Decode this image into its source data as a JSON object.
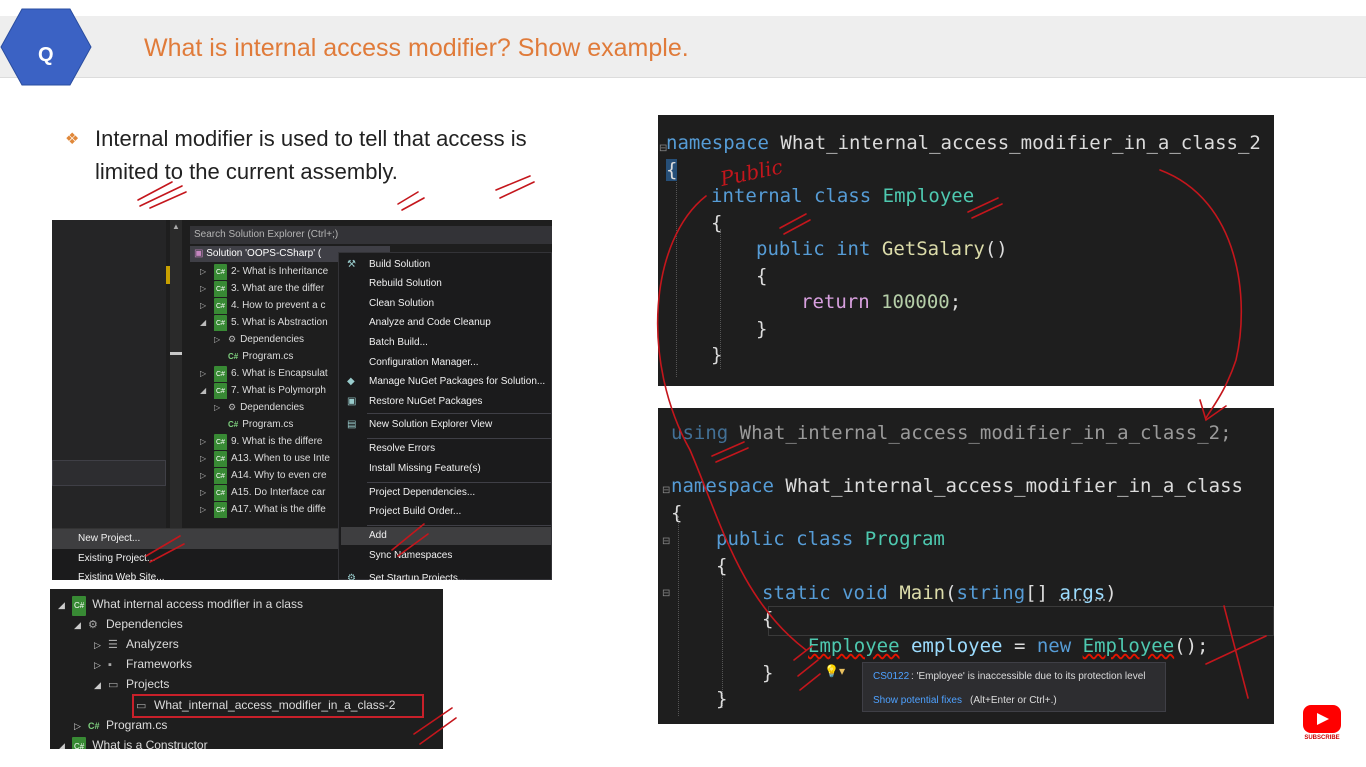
{
  "header": {
    "badge": "Q",
    "title": "What is internal access modifier? Show example."
  },
  "bullet": {
    "icon": "diamond-bullet-icon",
    "text": "Internal modifier is used to tell that access is limited to the current assembly."
  },
  "solution_explorer": {
    "search_placeholder": "Search Solution Explorer (Ctrl+;)",
    "solution_label": "Solution 'OOPS-CSharp' (",
    "tree": [
      {
        "label": "2- What is Inheritance",
        "type": "cs"
      },
      {
        "label": "3. What are the differ",
        "type": "cs"
      },
      {
        "label": "4. How to prevent a c",
        "type": "cs"
      },
      {
        "label": "5. What is Abstraction",
        "type": "cs"
      },
      {
        "label": "Dependencies",
        "type": "dep"
      },
      {
        "label": "Program.cs",
        "type": "file"
      },
      {
        "label": "6. What is Encapsulat",
        "type": "cs"
      },
      {
        "label": "7. What is Polymorph",
        "type": "cs"
      },
      {
        "label": "Dependencies",
        "type": "dep"
      },
      {
        "label": "Program.cs",
        "type": "file"
      },
      {
        "label": "9. What is the differe",
        "type": "cs"
      },
      {
        "label": "A13. When to use Inte",
        "type": "cs"
      },
      {
        "label": "A14. Why to even cre",
        "type": "cs"
      },
      {
        "label": "A15. Do Interface car",
        "type": "cs"
      },
      {
        "label": "A17. What is the diffe",
        "type": "cs"
      }
    ],
    "context_menu": [
      "Build Solution",
      "Rebuild Solution",
      "Clean Solution",
      "Analyze and Code Cleanup",
      "Batch Build...",
      "Configuration Manager...",
      "Manage NuGet Packages for Solution...",
      "Restore NuGet Packages",
      "New Solution Explorer View",
      "Resolve Errors",
      "Install Missing Feature(s)",
      "Project Dependencies...",
      "Project Build Order...",
      "Add",
      "Sync Namespaces",
      "Set Startup Projects..."
    ],
    "add_submenu": [
      "New Project...",
      "Existing Project...",
      "Existing Web Site..."
    ]
  },
  "project_tree": [
    {
      "label": "What internal access modifier in a class",
      "kind": "project"
    },
    {
      "label": "Dependencies",
      "kind": "deps"
    },
    {
      "label": "Analyzers",
      "kind": "analyzers"
    },
    {
      "label": "Frameworks",
      "kind": "frameworks"
    },
    {
      "label": "Projects",
      "kind": "projects"
    },
    {
      "label": "What_internal_access_modifier_in_a_class-2",
      "kind": "reference"
    },
    {
      "label": "Program.cs",
      "kind": "file"
    },
    {
      "label": "What is a Constructor",
      "kind": "project"
    }
  ],
  "code1": {
    "ns_kw": "namespace",
    "ns_name": "What_internal_access_modifier_in_a_class_2",
    "brace_open": "{",
    "class_mod": "internal",
    "class_kw": "class",
    "class_name": "Employee",
    "inner_open": "{",
    "method_mod": "public",
    "method_type": "int",
    "method_name": "GetSalary",
    "method_parens": "()",
    "m_open": "{",
    "ret_kw": "return",
    "ret_val": "100000",
    "semicolon": ";",
    "m_close": "}",
    "inner_close": "}"
  },
  "code2": {
    "using_kw": "using",
    "using_ns": "What_internal_access_modifier_in_a_class_2;",
    "ns_kw": "namespace",
    "ns_name": "What_internal_access_modifier_in_a_class",
    "brace_open": "{",
    "class_mod": "public",
    "class_kw": "class",
    "class_name": "Program",
    "c_open": "{",
    "static_kw": "static",
    "void_kw": "void",
    "main_name": "Main",
    "paren_open": "(",
    "string_kw": "string",
    "arr": "[]",
    "args": "args",
    "paren_close": ")",
    "m_open": "{",
    "type1": "Employee",
    "var": "employee",
    "eq": "=",
    "new_kw": "new",
    "type2": "Employee",
    "ctor": "();",
    "m_close": "}",
    "c_close": "}"
  },
  "error_popup": {
    "code": "CS0122",
    "message": ": 'Employee' is inaccessible due to its protection level",
    "fix_link": "Show potential fixes",
    "fix_keys": "(Alt+Enter or Ctrl+.)"
  },
  "annotations": {
    "handwritten": "Public"
  },
  "youtube": {
    "label": "SUBSCRIBE",
    "color": "#ff0000"
  }
}
